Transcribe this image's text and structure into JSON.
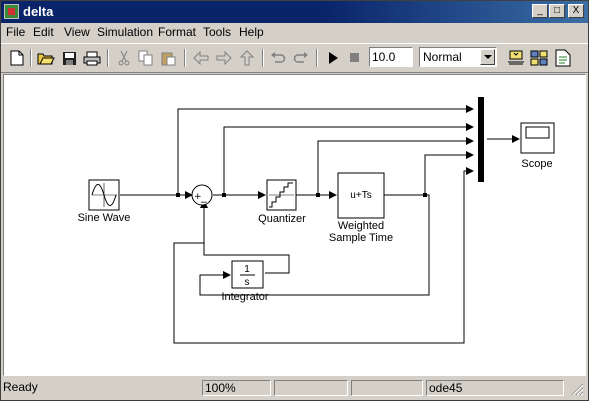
{
  "window": {
    "title": "delta"
  },
  "titlebar_buttons": [
    {
      "name": "minimize-button",
      "glyph": "_"
    },
    {
      "name": "maximize-button",
      "glyph": "□"
    },
    {
      "name": "close-button",
      "glyph": "X"
    }
  ],
  "menu": [
    "File",
    "Edit",
    "View",
    "Simulation",
    "Format",
    "Tools",
    "Help"
  ],
  "toolbar": {
    "stop_time": "10.0",
    "sim_mode": "Normal",
    "icons": [
      "new-icon",
      "open-icon",
      "save-icon",
      "print-icon",
      "cut-icon",
      "copy-icon",
      "paste-icon",
      "back-icon",
      "forward-icon",
      "up-icon",
      "undo-icon",
      "redo-icon",
      "start-icon",
      "stop-icon",
      "build-icon",
      "library-icon",
      "debug-icon"
    ]
  },
  "blocks": {
    "sine_wave": "Sine Wave",
    "sum_plus": "+",
    "sum_minus": "−",
    "quantizer": "Quantizer",
    "weighted_expr": "u+Ts",
    "weighted_line1": "Weighted",
    "weighted_line2": "Sample Time",
    "integrator_num": "1",
    "integrator_den": "s",
    "integrator": "Integrator",
    "scope": "Scope"
  },
  "status": {
    "state": "Ready",
    "zoom": "100%",
    "solver": "ode45"
  }
}
